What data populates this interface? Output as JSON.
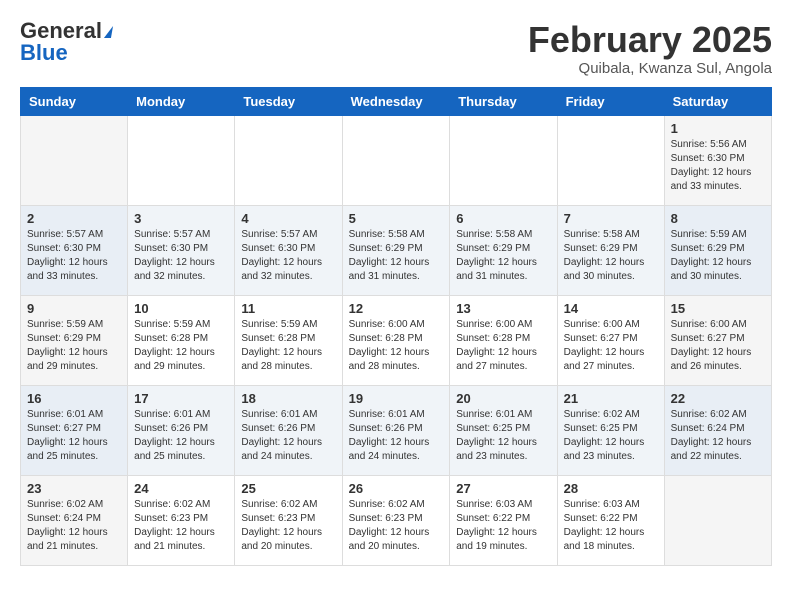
{
  "header": {
    "logo_general": "General",
    "logo_blue": "Blue",
    "month_year": "February 2025",
    "location": "Quibala, Kwanza Sul, Angola"
  },
  "days_of_week": [
    "Sunday",
    "Monday",
    "Tuesday",
    "Wednesday",
    "Thursday",
    "Friday",
    "Saturday"
  ],
  "weeks": [
    [
      {
        "day": "",
        "info": ""
      },
      {
        "day": "",
        "info": ""
      },
      {
        "day": "",
        "info": ""
      },
      {
        "day": "",
        "info": ""
      },
      {
        "day": "",
        "info": ""
      },
      {
        "day": "",
        "info": ""
      },
      {
        "day": "1",
        "info": "Sunrise: 5:56 AM\nSunset: 6:30 PM\nDaylight: 12 hours\nand 33 minutes."
      }
    ],
    [
      {
        "day": "2",
        "info": "Sunrise: 5:57 AM\nSunset: 6:30 PM\nDaylight: 12 hours\nand 33 minutes."
      },
      {
        "day": "3",
        "info": "Sunrise: 5:57 AM\nSunset: 6:30 PM\nDaylight: 12 hours\nand 32 minutes."
      },
      {
        "day": "4",
        "info": "Sunrise: 5:57 AM\nSunset: 6:30 PM\nDaylight: 12 hours\nand 32 minutes."
      },
      {
        "day": "5",
        "info": "Sunrise: 5:58 AM\nSunset: 6:29 PM\nDaylight: 12 hours\nand 31 minutes."
      },
      {
        "day": "6",
        "info": "Sunrise: 5:58 AM\nSunset: 6:29 PM\nDaylight: 12 hours\nand 31 minutes."
      },
      {
        "day": "7",
        "info": "Sunrise: 5:58 AM\nSunset: 6:29 PM\nDaylight: 12 hours\nand 30 minutes."
      },
      {
        "day": "8",
        "info": "Sunrise: 5:59 AM\nSunset: 6:29 PM\nDaylight: 12 hours\nand 30 minutes."
      }
    ],
    [
      {
        "day": "9",
        "info": "Sunrise: 5:59 AM\nSunset: 6:29 PM\nDaylight: 12 hours\nand 29 minutes."
      },
      {
        "day": "10",
        "info": "Sunrise: 5:59 AM\nSunset: 6:28 PM\nDaylight: 12 hours\nand 29 minutes."
      },
      {
        "day": "11",
        "info": "Sunrise: 5:59 AM\nSunset: 6:28 PM\nDaylight: 12 hours\nand 28 minutes."
      },
      {
        "day": "12",
        "info": "Sunrise: 6:00 AM\nSunset: 6:28 PM\nDaylight: 12 hours\nand 28 minutes."
      },
      {
        "day": "13",
        "info": "Sunrise: 6:00 AM\nSunset: 6:28 PM\nDaylight: 12 hours\nand 27 minutes."
      },
      {
        "day": "14",
        "info": "Sunrise: 6:00 AM\nSunset: 6:27 PM\nDaylight: 12 hours\nand 27 minutes."
      },
      {
        "day": "15",
        "info": "Sunrise: 6:00 AM\nSunset: 6:27 PM\nDaylight: 12 hours\nand 26 minutes."
      }
    ],
    [
      {
        "day": "16",
        "info": "Sunrise: 6:01 AM\nSunset: 6:27 PM\nDaylight: 12 hours\nand 25 minutes."
      },
      {
        "day": "17",
        "info": "Sunrise: 6:01 AM\nSunset: 6:26 PM\nDaylight: 12 hours\nand 25 minutes."
      },
      {
        "day": "18",
        "info": "Sunrise: 6:01 AM\nSunset: 6:26 PM\nDaylight: 12 hours\nand 24 minutes."
      },
      {
        "day": "19",
        "info": "Sunrise: 6:01 AM\nSunset: 6:26 PM\nDaylight: 12 hours\nand 24 minutes."
      },
      {
        "day": "20",
        "info": "Sunrise: 6:01 AM\nSunset: 6:25 PM\nDaylight: 12 hours\nand 23 minutes."
      },
      {
        "day": "21",
        "info": "Sunrise: 6:02 AM\nSunset: 6:25 PM\nDaylight: 12 hours\nand 23 minutes."
      },
      {
        "day": "22",
        "info": "Sunrise: 6:02 AM\nSunset: 6:24 PM\nDaylight: 12 hours\nand 22 minutes."
      }
    ],
    [
      {
        "day": "23",
        "info": "Sunrise: 6:02 AM\nSunset: 6:24 PM\nDaylight: 12 hours\nand 21 minutes."
      },
      {
        "day": "24",
        "info": "Sunrise: 6:02 AM\nSunset: 6:23 PM\nDaylight: 12 hours\nand 21 minutes."
      },
      {
        "day": "25",
        "info": "Sunrise: 6:02 AM\nSunset: 6:23 PM\nDaylight: 12 hours\nand 20 minutes."
      },
      {
        "day": "26",
        "info": "Sunrise: 6:02 AM\nSunset: 6:23 PM\nDaylight: 12 hours\nand 20 minutes."
      },
      {
        "day": "27",
        "info": "Sunrise: 6:03 AM\nSunset: 6:22 PM\nDaylight: 12 hours\nand 19 minutes."
      },
      {
        "day": "28",
        "info": "Sunrise: 6:03 AM\nSunset: 6:22 PM\nDaylight: 12 hours\nand 18 minutes."
      },
      {
        "day": "",
        "info": ""
      }
    ]
  ]
}
